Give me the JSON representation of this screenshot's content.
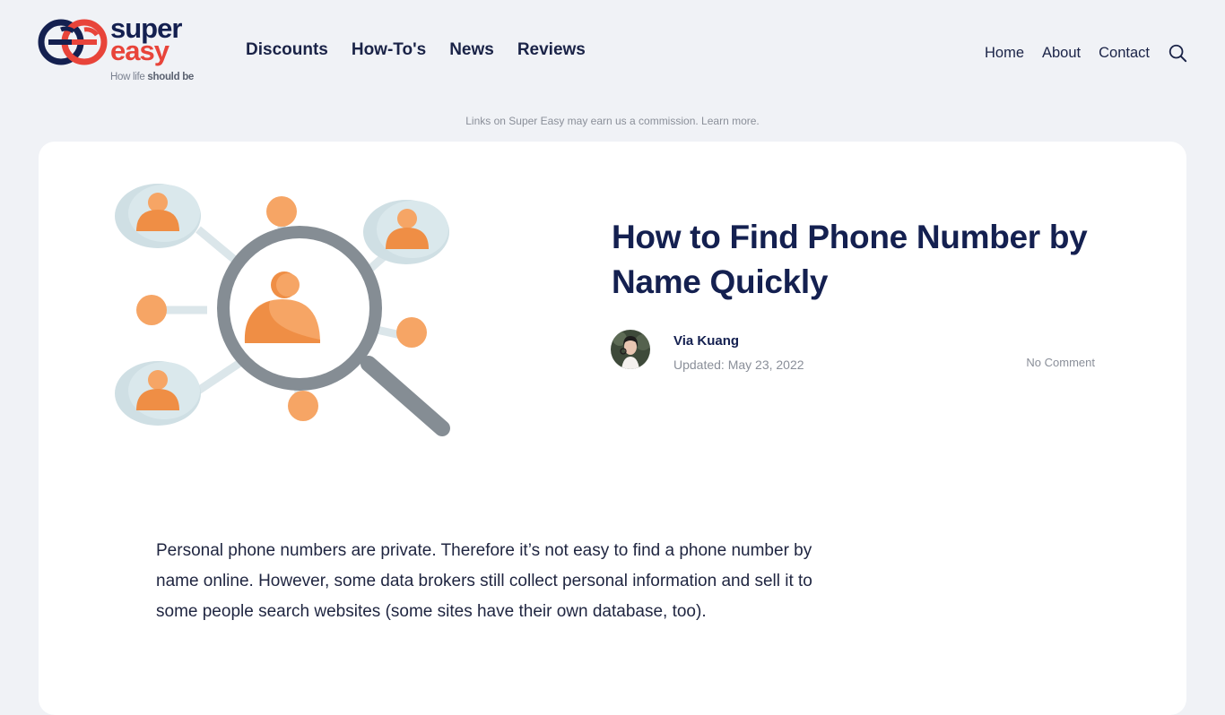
{
  "header": {
    "logo": {
      "word_top": "super",
      "word_bottom": "easy",
      "tagline_prefix": "How life ",
      "tagline_bold": "should be",
      "colors": {
        "navy": "#142050",
        "red": "#e8443a"
      }
    },
    "main_nav": [
      {
        "label": "Discounts"
      },
      {
        "label": "How-To's"
      },
      {
        "label": "News"
      },
      {
        "label": "Reviews"
      }
    ],
    "secondary_nav": [
      {
        "label": "Home"
      },
      {
        "label": "About"
      },
      {
        "label": "Contact"
      }
    ],
    "search_icon": "search-icon"
  },
  "disclosure": {
    "text": "Links on Super Easy may earn us a commission.",
    "link": "Learn more."
  },
  "article": {
    "hero_image": "magnifying-glass-people-network-illustration",
    "title": "How to Find Phone Number by Name Quickly",
    "author": "Via Kuang",
    "updated": "Updated: May 23, 2022",
    "comments": "No Comment",
    "intro": "Personal phone numbers are private. Therefore it’s not easy to find a phone number by name online. However, some data brokers still collect personal information and sell it to some people search websites (some sites have their own database, too)."
  },
  "colors": {
    "page_bg": "#f0f2f6",
    "card_bg": "#ffffff",
    "heading": "#142050",
    "muted": "#8a8f99",
    "accent_orange": "#f6a565",
    "accent_red": "#e8443a"
  }
}
